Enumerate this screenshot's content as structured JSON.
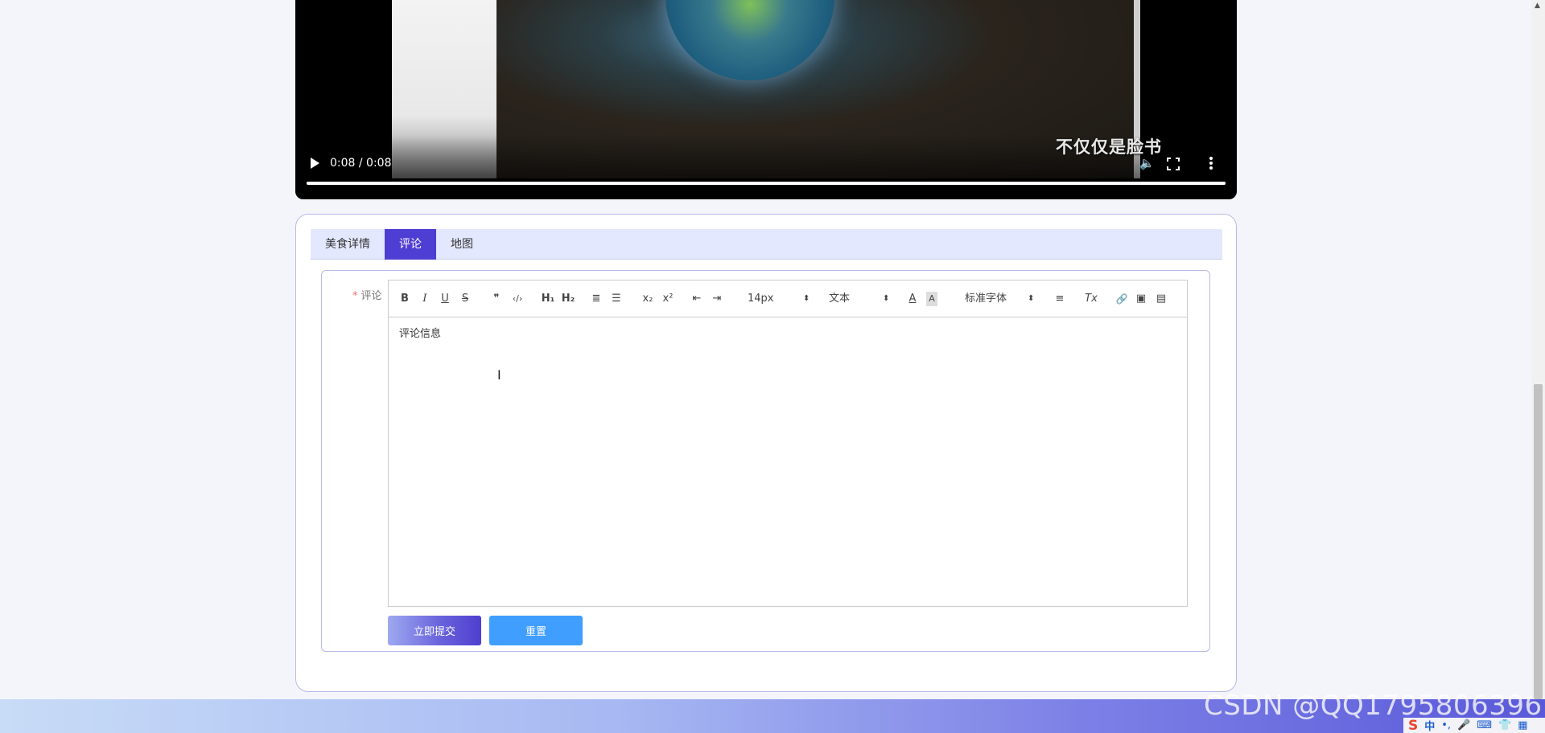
{
  "video": {
    "subtitle": "不仅仅是脸书",
    "time": "0:08 / 0:08",
    "progress": 1.0,
    "icons": [
      "play-icon",
      "volume-icon",
      "fullscreen-icon",
      "more-vertical-icon"
    ]
  },
  "tabs": [
    {
      "label": "美食详情",
      "active": false
    },
    {
      "label": "评论",
      "active": true
    },
    {
      "label": "地图",
      "active": false
    }
  ],
  "form": {
    "required_mark": "*",
    "label": "评论",
    "editor": {
      "toolbar": {
        "bold": "B",
        "italic": "I",
        "underline": "U",
        "strike": "S",
        "quote": "❞",
        "code": "‹/›",
        "h1": "H₁",
        "h2": "H₂",
        "ordered_list": "≣",
        "bullet_list": "☰",
        "subscript": "x₂",
        "superscript": "x²",
        "outdent": "⇤",
        "indent": "⇥",
        "size_select": "14px",
        "header_select": "文本",
        "color": "A",
        "background": "A",
        "font_select": "标准字体",
        "align": "≡",
        "clean": "Tx",
        "link": "🔗",
        "image": "▣",
        "video": "▤",
        "select_arrow": "⬍"
      },
      "content": "评论信息"
    },
    "submit_label": "立即提交",
    "reset_label": "重置"
  },
  "watermark": "CSDN @QQ1795806396",
  "ime": {
    "logo": "S",
    "mode": "中",
    "punct": "•,",
    "mic": "🎤",
    "keyboard": "⌨",
    "shirt": "👕",
    "grid": "▦"
  },
  "colors": {
    "accent": "#4f3ed3",
    "tabs_bg": "#e4e8ff",
    "reset_button": "#409eff",
    "card_border": "#b7bae8"
  }
}
